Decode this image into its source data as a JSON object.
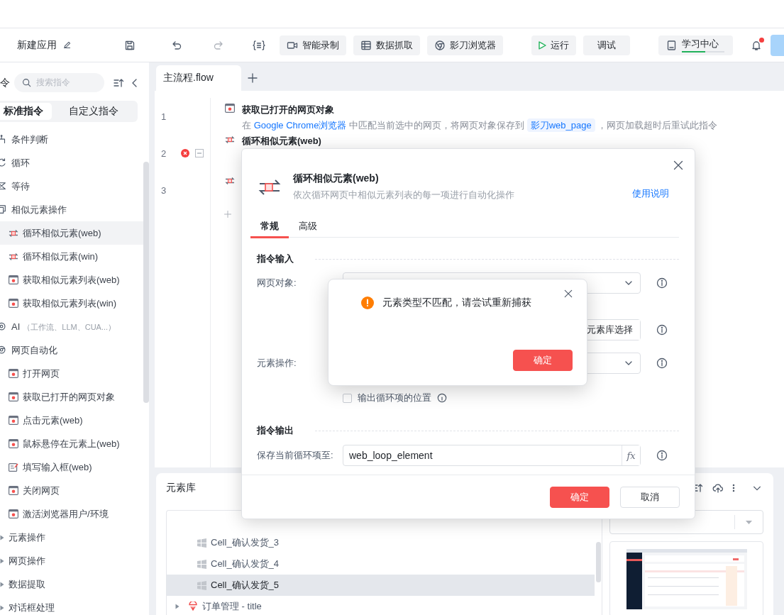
{
  "top_bar": {
    "app_name": "新建应用",
    "tools": [
      {
        "label": "智能录制",
        "kind": "record"
      },
      {
        "label": "数据抓取",
        "kind": "table"
      },
      {
        "label": "影刀浏览器",
        "kind": "browser"
      }
    ],
    "run": "运行",
    "debug": "调试",
    "learning": {
      "label": "学习中心",
      "level": 0.55
    },
    "notification": {
      "unread": true
    }
  },
  "sidebar": {
    "title": "令",
    "search": {
      "placeholder": "搜索指令"
    },
    "tabs": [
      {
        "label": "标准指令",
        "selected": true
      },
      {
        "label": "自定义指令",
        "selected": false
      }
    ],
    "items": [
      {
        "label": "条件判断",
        "kind": "branch"
      },
      {
        "label": "循环",
        "kind": "loop"
      },
      {
        "label": "等待",
        "kind": "wait"
      },
      {
        "label": "相似元素操作",
        "kind": "similar",
        "children": [
          {
            "label": "循环相似元素(web)",
            "kind": "loop",
            "selected": true
          },
          {
            "label": "循环相似元素(win)",
            "kind": "loop",
            "selected": false
          },
          {
            "label": "获取相似元素列表(web)",
            "kind": "window",
            "selected": false
          },
          {
            "label": "获取相似元素列表(win)",
            "kind": "window",
            "selected": false
          }
        ]
      },
      {
        "label": "AI",
        "hint": "（工作流、LLM、CUA...）",
        "kind": "ai"
      },
      {
        "label": "网页自动化",
        "kind": "web",
        "children": [
          {
            "label": "打开网页",
            "kind": "window",
            "selected": false
          },
          {
            "label": "获取已打开的网页对象",
            "kind": "window",
            "selected": false
          },
          {
            "label": "点击元素(web)",
            "kind": "window",
            "selected": false
          },
          {
            "label": "鼠标悬停在元素上(web)",
            "kind": "window",
            "selected": false
          },
          {
            "label": "填写输入框(web)",
            "kind": "input",
            "selected": false
          },
          {
            "label": "关闭网页",
            "kind": "window",
            "selected": false
          },
          {
            "label": "激活浏览器用户/环境",
            "kind": "window",
            "selected": false
          }
        ]
      },
      {
        "label": "元素操作",
        "kind": "folder",
        "expanded": false
      },
      {
        "label": "网页操作",
        "kind": "folder",
        "expanded": false
      },
      {
        "label": "数据提取",
        "kind": "folder",
        "expanded": false
      },
      {
        "label": "对话框处理",
        "kind": "folder",
        "expanded": false
      }
    ]
  },
  "editor": {
    "tabs": [
      {
        "label": "主流程.flow",
        "selected": true
      }
    ],
    "steps": [
      {
        "line": "1",
        "kind": "window",
        "title": "获取已打开的网页对象",
        "description": [
          {
            "text": "在 "
          },
          {
            "text": "Google Chrome浏览器",
            "kind": "link"
          },
          {
            "text": " 中匹配当前选中的网页，将网页对象保存到 "
          },
          {
            "text": "影刀web_page",
            "kind": "variable"
          },
          {
            "text": " ，网页加载超时后重试此指令"
          }
        ]
      },
      {
        "line": "2",
        "kind": "loop",
        "title": "循环相似元素(web)",
        "error": true,
        "expanded": true
      },
      {
        "line": "3",
        "kind": "loop-end"
      }
    ]
  },
  "element_library": {
    "title": "元素库",
    "rows": [
      {
        "label": "Cell_确认发货_3",
        "kind": "windows",
        "selected": false
      },
      {
        "label": "Cell_确认发货_4",
        "kind": "windows",
        "selected": false
      },
      {
        "label": "Cell_确认发货_5",
        "kind": "windows",
        "selected": true
      },
      {
        "label": "订单管理 - title",
        "kind": "web",
        "expanded": false,
        "selected": false
      }
    ]
  },
  "dialog": {
    "title": "循环相似元素(web)",
    "subtitle": "依次循环网页中相似元素列表的每一项进行自动化操作",
    "help_link": "使用说明",
    "tabs": [
      {
        "label": "常规",
        "selected": true
      },
      {
        "label": "高级",
        "selected": false
      }
    ],
    "input_section": "指令输入",
    "fields": [
      {
        "label": "网页对象:",
        "kind": "select"
      },
      {
        "kind": "picker",
        "button": "元素库选择"
      },
      {
        "label": "元素操作:",
        "kind": "select"
      }
    ],
    "checkbox": {
      "label": "输出循环项的位置",
      "checked": false
    },
    "output_section": "指令输出",
    "output_field": {
      "label": "保存当前循环项至:",
      "value": "web_loop_element",
      "formula_button": "fx"
    },
    "buttons": [
      {
        "label": "确定",
        "kind": "primary"
      },
      {
        "label": "取消",
        "kind": "default"
      }
    ]
  },
  "alert": {
    "message": "元素类型不匹配，请尝试重新捕获",
    "confirm": "确定"
  }
}
